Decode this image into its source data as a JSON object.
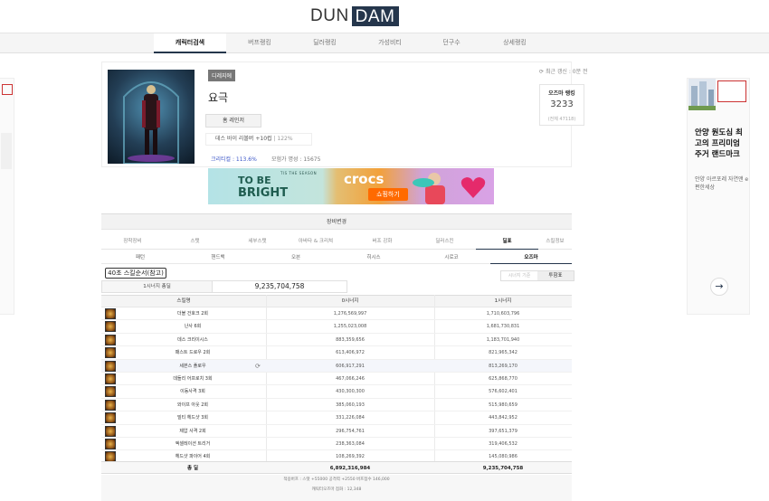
{
  "logo": {
    "part1": "DUN",
    "part2": "DAM"
  },
  "nav": [
    {
      "label": "캐릭터검색",
      "active": true
    },
    {
      "label": "버프랭킹",
      "active": false
    },
    {
      "label": "딜러랭킹",
      "active": false
    },
    {
      "label": "가성비티",
      "active": false
    },
    {
      "label": "던구수",
      "active": false
    },
    {
      "label": "상세랭킹",
      "active": false
    }
  ],
  "right_ad": {
    "title": "안양 원도심 최고의 프리미엄 주거 랜드마크",
    "subtitle": "안양 아르포레 자연앤 e편한세상",
    "arrow": "→"
  },
  "profile": {
    "server_tag": "디레지에",
    "name": "요극",
    "guild_button": "홈 레인저",
    "title_main": "데스 바이 리볼버 +10컵",
    "title_sub": "122%",
    "crit": "크리티컬 : 113.6%",
    "adventure_fame": "모험가 명성 : 15675",
    "refresh": "최근 갱신 : 0분 전",
    "rank_label": "오즈마 랭킹",
    "rank_value": "3233",
    "rank_sub": "(전체 47118)"
  },
  "banner": {
    "tagline": "TIS THE SEASON",
    "line1": "TO BE",
    "line2": "BRIGHT",
    "brand": "crocs",
    "cta": "쇼핑하기"
  },
  "section_header": "장비변경",
  "tabs1": [
    {
      "label": "장착장비",
      "active": false
    },
    {
      "label": "스탯",
      "active": false
    },
    {
      "label": "세부스탯",
      "active": false
    },
    {
      "label": "아바타 & 크리쳐",
      "active": false
    },
    {
      "label": "버프 강화",
      "active": false
    },
    {
      "label": "딜러스킨",
      "active": false
    },
    {
      "label": "딜표",
      "active": true
    },
    {
      "label": "스킬정보",
      "active": false
    }
  ],
  "tabs2": [
    {
      "label": "패턴",
      "active": false
    },
    {
      "label": "핸드백",
      "active": false
    },
    {
      "label": "오븐",
      "active": false
    },
    {
      "label": "히시스",
      "active": false
    },
    {
      "label": "시로코",
      "active": false
    },
    {
      "label": "오즈마",
      "active": true
    }
  ],
  "skill_order_button": "40초 스킬순서(참고)",
  "toggle": {
    "left": "시너지 기준",
    "right": "투함표"
  },
  "synergy_summary": {
    "label": "1시너지 총딜",
    "value": "9,235,704,758"
  },
  "table": {
    "headers": [
      "스킬명",
      "0시너지",
      "1시너지"
    ],
    "rows": [
      {
        "name": "더블 건호크 2회",
        "v0": "1,276,569,997",
        "v1": "1,710,603,796"
      },
      {
        "name": "난사 6회",
        "v0": "1,255,023,008",
        "v1": "1,681,730,831"
      },
      {
        "name": "데스 크리이시스",
        "v0": "883,359,656",
        "v1": "1,183,701,940"
      },
      {
        "name": "패스트 드로우 2회",
        "v0": "613,406,972",
        "v1": "821,965,342"
      },
      {
        "name": "세븐스 플로우",
        "v0": "606,917,291",
        "v1": "813,269,170",
        "highlight": true
      },
      {
        "name": "데들리 어프로치 3회",
        "v0": "467,066,246",
        "v1": "625,868,770"
      },
      {
        "name": "이동사격 3회",
        "v0": "430,300,300",
        "v1": "576,602,401"
      },
      {
        "name": "와이프 아웃 2회",
        "v0": "385,060,193",
        "v1": "515,980,659"
      },
      {
        "name": "빌티 헤드샷 3회",
        "v0": "331,226,084",
        "v1": "443,842,952"
      },
      {
        "name": "제압 사격 2회",
        "v0": "296,754,761",
        "v1": "397,651,379"
      },
      {
        "name": "엑셀레이션 트리거",
        "v0": "238,363,084",
        "v1": "319,406,532"
      },
      {
        "name": "헤드샷 파이어 4회",
        "v0": "108,269,392",
        "v1": "145,080,986"
      }
    ],
    "total": {
      "name": "총 딜",
      "v0": "6,892,316,984",
      "v1": "9,235,704,758"
    }
  },
  "footer": {
    "line1": "적용버프 : 스탯 +55000 공격력 +2550 버프점수 146,000",
    "line2": "캐릭터오즈마 점화 : 12,348"
  },
  "colors": {
    "brand": "#25364c",
    "crit_text": "#3a55c7",
    "banner_cta": "#ff6a00"
  }
}
